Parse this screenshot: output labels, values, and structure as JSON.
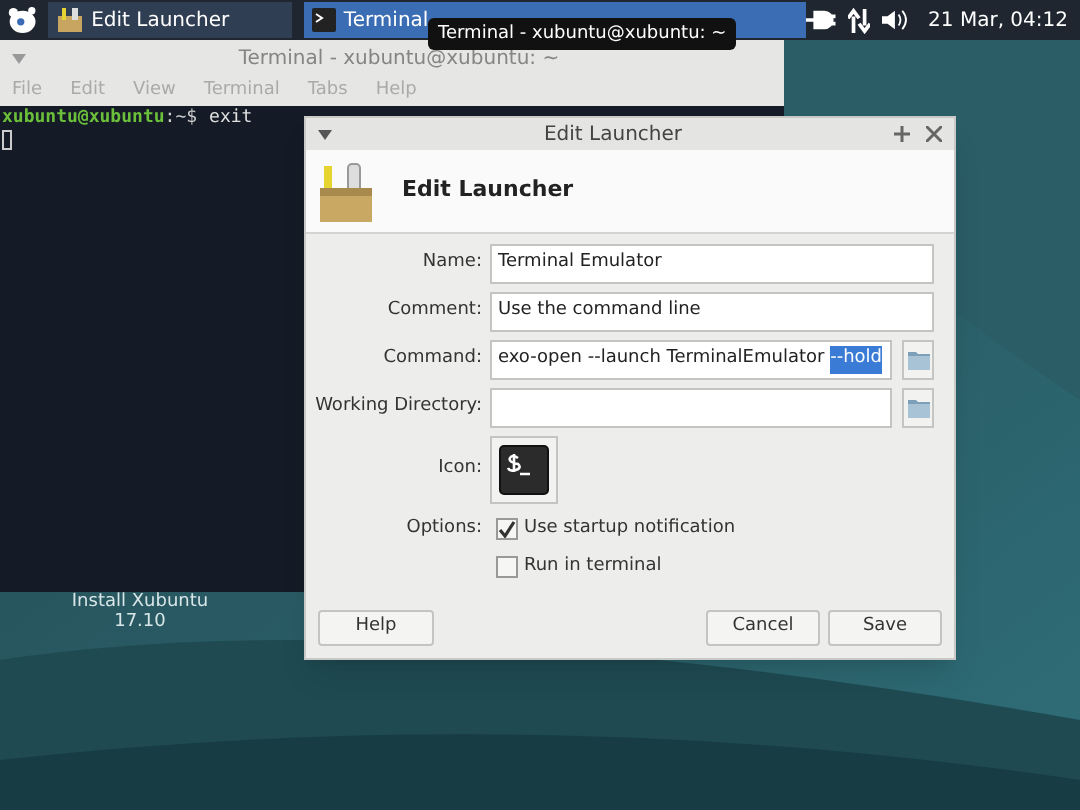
{
  "taskbar": {
    "items": [
      {
        "label": "Edit Launcher",
        "kind": "launcher",
        "selected": false
      },
      {
        "label": "Terminal",
        "kind": "terminal",
        "selected": true
      }
    ],
    "clock": "21 Mar, 04:12"
  },
  "tooltip": "Terminal - xubuntu@xubuntu: ~",
  "terminal_window": {
    "title": "Terminal - xubuntu@xubuntu: ~",
    "menu": [
      "File",
      "Edit",
      "View",
      "Terminal",
      "Tabs",
      "Help"
    ],
    "prompt_user": "xubuntu@xubuntu",
    "prompt_path": ":~$",
    "command": "exit"
  },
  "desktop_icon": {
    "label": "Install Xubuntu",
    "version": "17.10"
  },
  "dialog": {
    "title": "Edit Launcher",
    "heading": "Edit Launcher",
    "fields": [
      {
        "kind": "text",
        "label": "Name:",
        "value": "Terminal Emulator"
      },
      {
        "kind": "text",
        "label": "Comment:",
        "value": "Use the command line"
      },
      {
        "kind": "browse",
        "label": "Command:",
        "value": "exo-open --launch TerminalEmulator ",
        "selected_text": "--hold"
      },
      {
        "kind": "browse",
        "label": "Working Directory:"
      },
      {
        "kind": "icon",
        "label": "Icon:"
      }
    ],
    "options_label": "Options:",
    "options": [
      {
        "label": "Use startup notification",
        "checked": true
      },
      {
        "label": "Run in terminal",
        "checked": false
      }
    ],
    "buttons": [
      {
        "label": "Help",
        "kind": "left"
      },
      {
        "label": "Cancel",
        "kind": "right"
      },
      {
        "label": "Save",
        "kind": "right"
      }
    ]
  }
}
